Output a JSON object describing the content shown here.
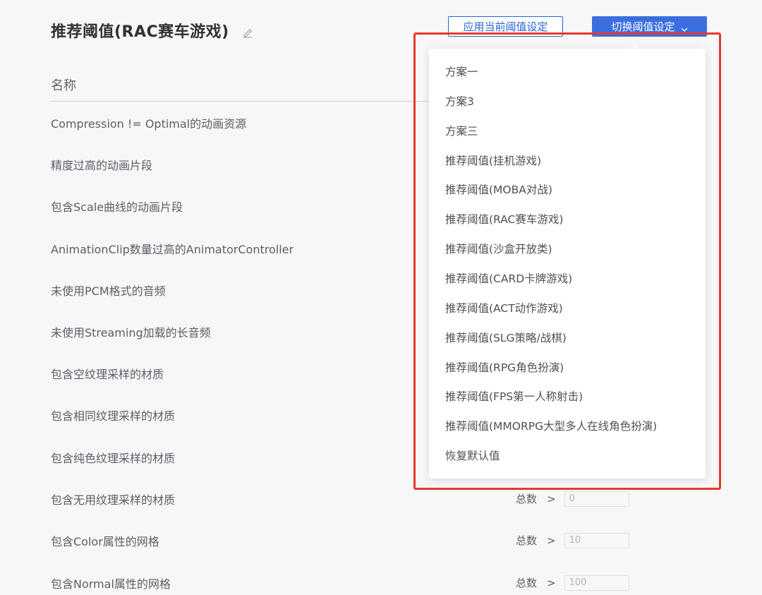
{
  "header": {
    "title": "推荐阈值(RAC赛车游戏)",
    "apply_label": "应用当前阈值设定",
    "switch_label": "切换阈值设定"
  },
  "table": {
    "column_name": "名称",
    "rows": [
      {
        "label": "Compression != Optimal的动画资源"
      },
      {
        "label": "精度过高的动画片段"
      },
      {
        "label": "包含Scale曲线的动画片段"
      },
      {
        "label": "AnimationClip数量过高的AnimatorController"
      },
      {
        "label": "未使用PCM格式的音频"
      },
      {
        "label": "未使用Streaming加载的长音频"
      },
      {
        "label": "包含空纹理采样的材质"
      },
      {
        "label": "包含相同纹理采样的材质"
      },
      {
        "label": "包含纯色纹理采样的材质"
      },
      {
        "label": "包含无用纹理采样的材质",
        "metric": "总数",
        "op": ">",
        "value": "0"
      },
      {
        "label": "包含Color属性的网格",
        "metric": "总数",
        "op": ">",
        "value": "10"
      },
      {
        "label": "包含Normal属性的网格",
        "metric": "总数",
        "op": ">",
        "value": "100"
      }
    ]
  },
  "dropdown": {
    "items": [
      "方案一",
      "方案3",
      "方案三",
      "推荐阈值(挂机游戏)",
      "推荐阈值(MOBA对战)",
      "推荐阈值(RAC赛车游戏)",
      "推荐阈值(沙盒开放类)",
      "推荐阈值(CARD卡牌游戏)",
      "推荐阈值(ACT动作游戏)",
      "推荐阈值(SLG策略/战棋)",
      "推荐阈值(RPG角色扮演)",
      "推荐阈值(FPS第一人称射击)",
      "推荐阈值(MMORPG大型多人在线角色扮演)",
      "恢复默认值"
    ]
  },
  "colors": {
    "primary": "#3b6fe0",
    "highlight": "#e43a2e"
  },
  "icons": {
    "edit": "pencil-icon",
    "switch": "chevron-down-icon"
  }
}
